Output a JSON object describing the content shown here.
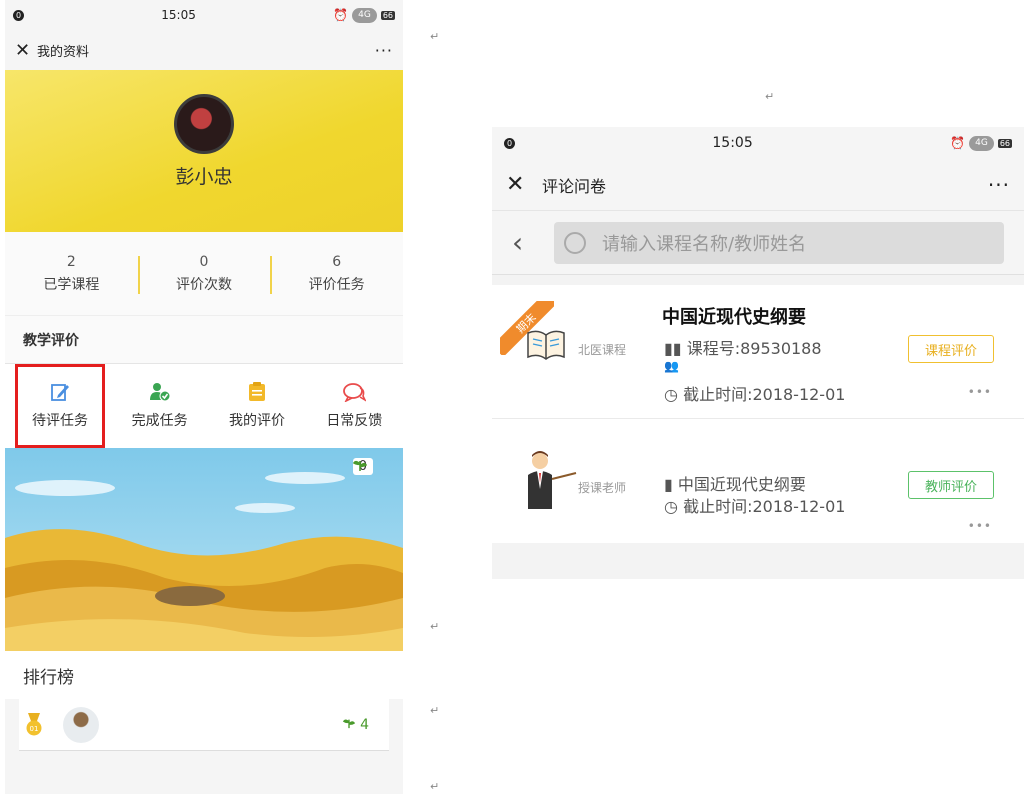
{
  "left": {
    "status": {
      "time": "15:05",
      "notice": "0",
      "network": "4G",
      "battery": "66"
    },
    "nav": {
      "close": "✕",
      "title": "我的资料",
      "more": "···"
    },
    "profile": {
      "name": "彭小忠"
    },
    "stats": [
      {
        "value": "2",
        "label": "已学课程"
      },
      {
        "value": "0",
        "label": "评价次数"
      },
      {
        "value": "6",
        "label": "评价任务"
      }
    ],
    "section_title": "教学评价",
    "grid": [
      {
        "label": "待评任务",
        "icon": "edit-icon",
        "color": "#4a8fe0"
      },
      {
        "label": "完成任务",
        "icon": "user-check-icon",
        "color": "#3aa552"
      },
      {
        "label": "我的评价",
        "icon": "note-icon",
        "color": "#f2b92a"
      },
      {
        "label": "日常反馈",
        "icon": "chat-icon",
        "color": "#e94b4b"
      }
    ],
    "scene_badge": "0",
    "rank": {
      "title": "排行榜",
      "score": "4",
      "medal_number": "01"
    }
  },
  "right": {
    "status": {
      "time": "15:05",
      "notice": "0",
      "network": "4G",
      "battery": "66"
    },
    "nav": {
      "close": "✕",
      "title": "评论问卷",
      "more": "···"
    },
    "search": {
      "placeholder": "请输入课程名称/教师姓名"
    },
    "cards": [
      {
        "ribbon": "期末",
        "source": "北医课程",
        "name": "中国近现代史纲要",
        "course_no": "课程号:89530188",
        "deadline": "截止时间:2018-12-01",
        "tag": "课程评价",
        "more": "•••"
      },
      {
        "source": "授课老师",
        "course": "中国近现代史纲要",
        "deadline": "截止时间:2018-12-01",
        "tag": "教师评价",
        "more": "•••"
      }
    ]
  },
  "marks": [
    "↵",
    "↵",
    "↵",
    "↵",
    "↵",
    "↵"
  ]
}
